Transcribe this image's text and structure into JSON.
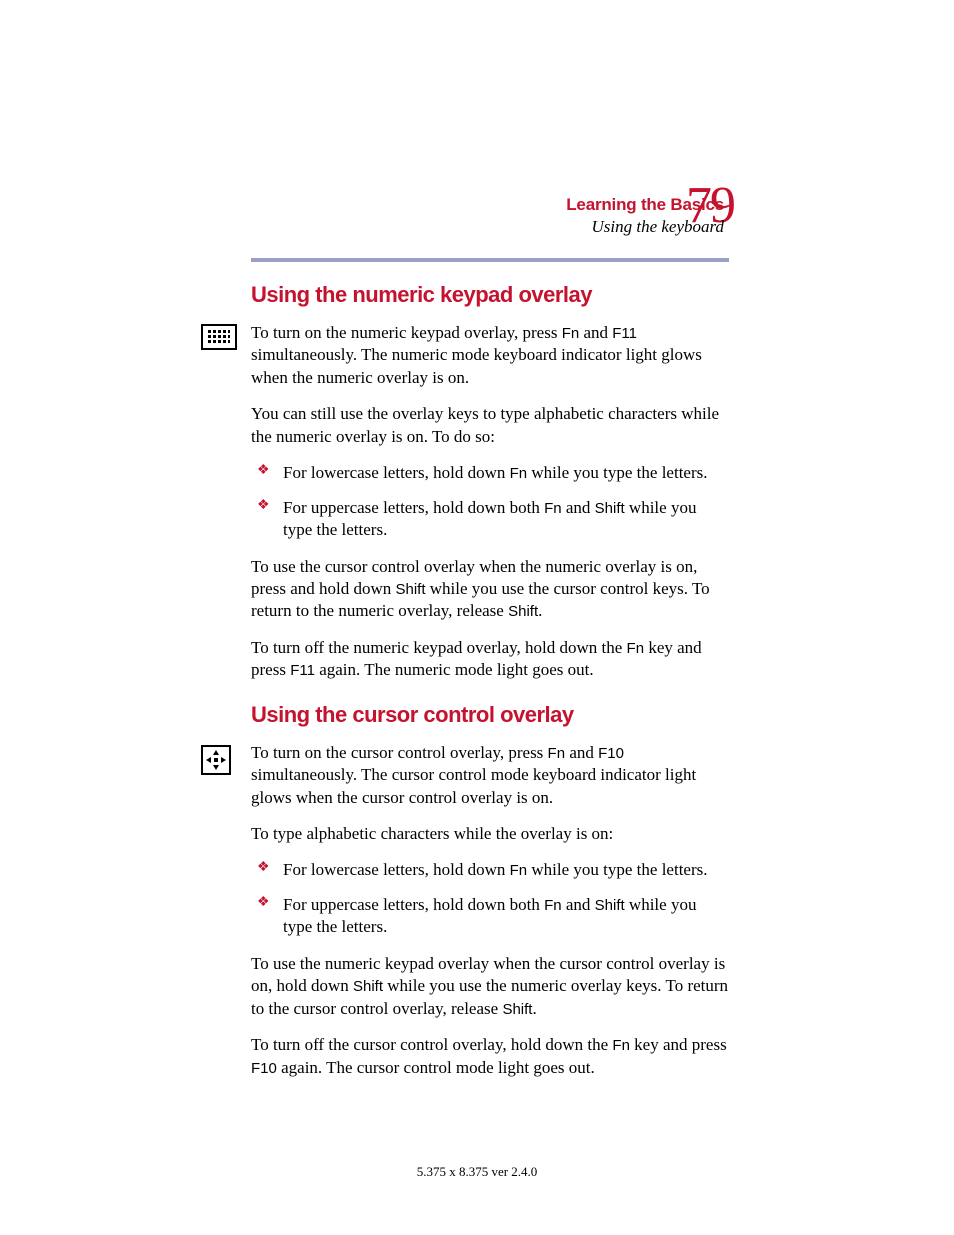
{
  "header": {
    "chapter": "Learning the Basics",
    "section": "Using the keyboard",
    "page_number": "79"
  },
  "sec1": {
    "heading": "Using the numeric keypad overlay",
    "p1a": "To turn on the numeric keypad overlay, press ",
    "p1b": " and ",
    "p1c": " simultaneously. The numeric mode keyboard indicator light glows when the numeric overlay is on.",
    "p2": "You can still use the overlay keys to type alphabetic characters while the numeric overlay is on. To do so:",
    "li1a": "For lowercase letters, hold down ",
    "li1b": " while you type the letters.",
    "li2a": "For uppercase letters, hold down both ",
    "li2b": " and ",
    "li2c": " while you type the letters.",
    "p3a": "To use the cursor control overlay when the numeric overlay is on, press and hold down ",
    "p3b": " while you use the cursor control keys. To return to the numeric overlay, release ",
    "p3c": ".",
    "p4a": "To turn off the numeric keypad overlay, hold down the ",
    "p4b": " key and press ",
    "p4c": " again. The numeric mode light goes out."
  },
  "sec2": {
    "heading": "Using the cursor control overlay",
    "p1a": "To turn on the cursor control overlay, press ",
    "p1b": " and ",
    "p1c": " simultaneously. The cursor control mode keyboard indicator light glows when the cursor control overlay is on.",
    "p2": "To type alphabetic characters while the overlay is on:",
    "li1a": "For lowercase letters, hold down ",
    "li1b": " while you type the letters.",
    "li2a": "For uppercase letters, hold down both ",
    "li2b": " and ",
    "li2c": " while you type the letters.",
    "p3a": "To use the numeric keypad overlay when the cursor control overlay is on, hold down ",
    "p3b": " while you use the numeric overlay keys. To return to the cursor control overlay, release ",
    "p3c": ".",
    "p4a": "To turn off the cursor control overlay, hold down the ",
    "p4b": " key and press ",
    "p4c": " again. The cursor control mode light goes out."
  },
  "keys": {
    "fn": "Fn",
    "f11": "F11",
    "f10": "F10",
    "shift": "Shift"
  },
  "footer": "5.375 x 8.375 ver 2.4.0"
}
